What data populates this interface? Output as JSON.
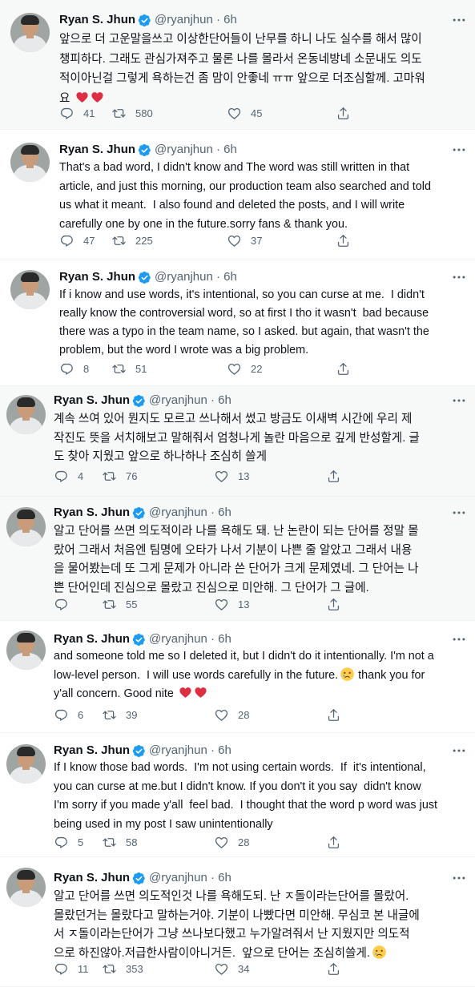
{
  "colors": {
    "text": "#0f1419",
    "muted": "#536471",
    "verified": "#1d9bf0",
    "highlight": "#f7f9f9",
    "divider": "#eff3f4",
    "heart": "#f91880"
  },
  "icons": [
    "verified-badge-icon",
    "more-icon",
    "reply-icon",
    "retweet-icon",
    "like-icon",
    "share-icon",
    "red-heart-emoji",
    "crying-face-emoji"
  ],
  "tweets": [
    {
      "name": "Ryan S. Jhun",
      "handle": "@ryanjhun",
      "sep": " · ",
      "time": "6h",
      "lines": [
        "앞으로 더 고운말을쓰고 이상한단어들이 난무를 하니 나도 실수를 해서 많이",
        "챙피하다. 그래도 관심가져주고 물론 나를 몰라서 온동네방네 소문내도 의도",
        "적이아닌걸 그렇게 욕하는건 좀 맘이 안좋네 ㅠㅠ 앞으로 더조심할께. 고마워",
        "요"
      ],
      "replies": "41",
      "retweets": "580",
      "likes": "45"
    },
    {
      "name": "Ryan S. Jhun",
      "handle": "@ryanjhun",
      "sep": " · ",
      "time": "6h",
      "lines": [
        "That's a bad word, I didn't know and The word was still written in that",
        "article, and just this morning, our production team also searched and told",
        "us what it meant.  I also found and deleted the posts, and I will write",
        "carefully one by one in the future.sorry fans & thank you."
      ],
      "replies": "47",
      "retweets": "225",
      "likes": "37"
    },
    {
      "name": "Ryan S. Jhun",
      "handle": "@ryanjhun",
      "sep": " · ",
      "time": "6h",
      "lines": [
        "If i know and use words, it's intentional, so you can curse at me.  I didn't",
        "really know the controversial word, so at first I tho it wasn't  bad because",
        "there was a typo in the team name, so I asked. but again, that wasn't the",
        "problem, but the word I wrote was a big problem."
      ],
      "replies": "8",
      "retweets": "51",
      "likes": "22"
    },
    {
      "name": "Ryan S. Jhun",
      "handle": "@ryanjhun",
      "sep": " · ",
      "time": "6h",
      "lines": [
        "계속 쓰여 있어 뭔지도 모르고 쓰나해서 썼고 방금도 이새벽 시간에 우리 제",
        "작진도 뜻을 서치해보고 말해줘서 엄청나게 놀란 마음으로 깊게 반성할게. 글",
        "도 찾아 지웠고 앞으로 하나하나 조심히 쓸게"
      ],
      "replies": "4",
      "retweets": "76",
      "likes": "13"
    },
    {
      "name": "Ryan S. Jhun",
      "handle": "@ryanjhun",
      "sep": " · ",
      "time": "6h",
      "lines": [
        "알고 단어를 쓰면 의도적이라 나를 욕해도 돼. 난 논란이 되는 단어를 정말 몰",
        "랐어 그래서 처음엔 팀명에 오타가 나서 기분이 나쁜 줄 알았고 그래서 내용",
        "을 물어봤는데 또 그게 문제가 아니라 쓴 단어가 크게 문제였네. 그 단어는 나",
        "쁜 단어인데 진심으로 몰랐고 진심으로 미안해. 그 단어가 그 글에."
      ],
      "replies": "",
      "retweets": "55",
      "likes": "13"
    },
    {
      "name": "Ryan S. Jhun",
      "handle": "@ryanjhun",
      "sep": " · ",
      "time": "6h",
      "lines": [
        "and someone told me so I deleted it, but I didn't do it intentionally. I'm not a",
        "low-level person.  I will use words carefully in the future.",
        "y'all concern. Good nite "
      ],
      "line_suffix": {
        "1": " thank you for"
      },
      "replies": "6",
      "retweets": "39",
      "likes": "28"
    },
    {
      "name": "Ryan S. Jhun",
      "handle": "@ryanjhun",
      "sep": " · ",
      "time": "6h",
      "lines": [
        "If I know those bad words.  I'm not using certain words.  If  it's intentional,",
        "you can curse at me.but I didn't know. If you don't it you say  didn't know",
        "I'm sorry if you made y'all  feel bad.  I thought that the word p word was just",
        "being used in my post I saw unintentionally"
      ],
      "replies": "5",
      "retweets": "58",
      "likes": "28"
    },
    {
      "name": "Ryan S. Jhun",
      "handle": "@ryanjhun",
      "sep": " · ",
      "time": "6h",
      "lines": [
        "알고 단어를 쓰면 의도적인것 나를 욕해도되. 난 ㅈ돌이라는단어를 몰랐어.",
        "몰랐던거는 몰랐다고 말하는거야. 기분이 나빴다면 미안해. 무심코 본 내글에",
        "서 ㅈ돌이라는단어가 그냥 쓰나보다했고 누가알려줘서 난 지웠지만 의도적",
        "으로 하진않아.저급한사람이아니거든.  앞으로 단어는 조심히쓸게."
      ],
      "replies": "11",
      "retweets": "353",
      "likes": "34"
    }
  ]
}
